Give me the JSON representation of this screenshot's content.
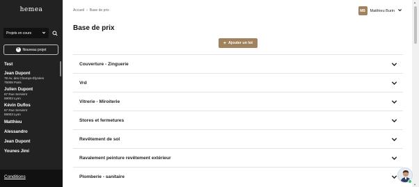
{
  "sidebar": {
    "logo": "hemea",
    "project_filter": "Projets en cours",
    "new_project_label": "Nouveau projet",
    "projects": [
      {
        "name": "Test",
        "address_line1": "",
        "address_line2": ""
      },
      {
        "name": "Jean Dupont",
        "address_line1": "78 Av. des Champs-Élysées",
        "address_line2": "75008 Paris"
      },
      {
        "name": "Julien Dupont",
        "address_line1": "67 Rue Servient",
        "address_line2": "69003 Lyon"
      },
      {
        "name": "Kévin Duflos",
        "address_line1": "67 Rue Servient",
        "address_line2": "69003 Lyon"
      },
      {
        "name": "Matthieu",
        "address_line1": "",
        "address_line2": ""
      },
      {
        "name": "Alessandro",
        "address_line1": "",
        "address_line2": ""
      },
      {
        "name": "Jean Dupont",
        "address_line1": "",
        "address_line2": ""
      },
      {
        "name": "Younes Jimi",
        "address_line1": "",
        "address_line2": ""
      }
    ],
    "footer_link": "Conditions"
  },
  "breadcrumb": {
    "home": "Accueil",
    "separator": "›",
    "current": "Base de prix"
  },
  "page_title": "Base de prix",
  "user": {
    "initials": "MB",
    "name": "Matthieu Burin"
  },
  "add_lot_label": "Ajouter un lot",
  "lots": [
    "Couverture - Zinguerie",
    "Vrd",
    "Vitrerie - Miroiterie",
    "Stores et fermetures",
    "Revêtement de sol",
    "Ravalement peinture revêtement extérieur",
    "Plomberie - sanitaire"
  ],
  "colors": {
    "sidebar_bg": "#222222",
    "accent": "#a0825e",
    "online": "#2ecc71"
  }
}
